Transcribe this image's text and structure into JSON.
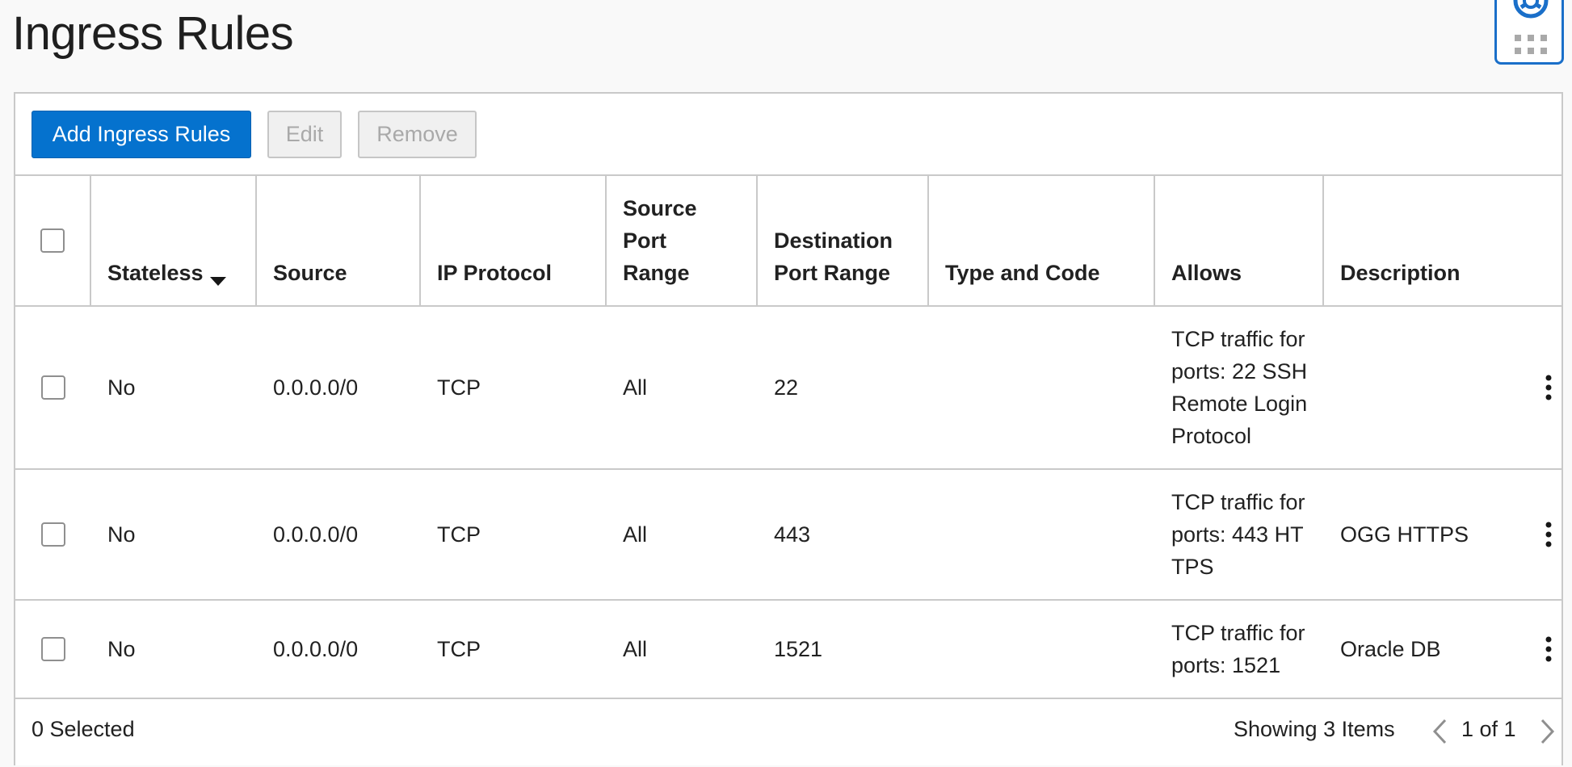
{
  "page": {
    "title": "Ingress Rules"
  },
  "help_widget": {
    "icons": [
      "lifebuoy-icon",
      "grid-dots-icon"
    ],
    "accent_color": "#1a6fc9"
  },
  "toolbar": {
    "add_label": "Add Ingress Rules",
    "edit_label": "Edit",
    "remove_label": "Remove",
    "primary_color": "#0572ce"
  },
  "table": {
    "headers": {
      "stateless": "Stateless",
      "source": "Source",
      "ip_protocol": "IP Protocol",
      "source_port_range": "Source Port Range",
      "destination_port_range": "Destination Port Range",
      "type_and_code": "Type and Code",
      "allows": "Allows",
      "description": "Description"
    },
    "sort_column": "Stateless",
    "sort_direction": "descending",
    "rows": [
      {
        "stateless": "No",
        "source": "0.0.0.0/0",
        "ip_protocol": "TCP",
        "source_port_range": "All",
        "destination_port_range": "22",
        "type_and_code": "",
        "allows": "TCP traffic for ports: 22 SSH Remote Login Protocol",
        "description": ""
      },
      {
        "stateless": "No",
        "source": "0.0.0.0/0",
        "ip_protocol": "TCP",
        "source_port_range": "All",
        "destination_port_range": "443",
        "type_and_code": "",
        "allows": "TCP traffic for ports: 443 HTTPS",
        "description": "OGG HTTPS"
      },
      {
        "stateless": "No",
        "source": "0.0.0.0/0",
        "ip_protocol": "TCP",
        "source_port_range": "All",
        "destination_port_range": "1521",
        "type_and_code": "",
        "allows": "TCP traffic for ports: 1521",
        "description": "Oracle DB"
      }
    ]
  },
  "footer": {
    "selected": "0 Selected",
    "showing": "Showing 3 Items",
    "page_indicator": "1 of 1"
  }
}
